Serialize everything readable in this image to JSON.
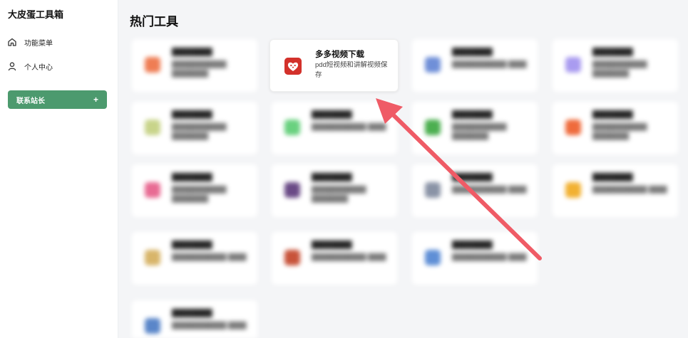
{
  "app": {
    "title": "大皮蛋工具箱"
  },
  "sidebar": {
    "items": [
      {
        "label": "功能菜单",
        "icon": "home-icon"
      },
      {
        "label": "个人中心",
        "icon": "user-icon"
      }
    ],
    "contact": {
      "label": "联系站长",
      "plus": "+"
    }
  },
  "main": {
    "title": "热门工具",
    "featured": {
      "name": "多多视频下载",
      "desc": "pdd短视频和讲解视频保存",
      "icon": "pinduoduo-logo-icon",
      "color": "#d3312b"
    },
    "blurred_cards": [
      {
        "name": "████████",
        "desc": "████████████ ████████",
        "color": "#ef7d54"
      },
      {
        "name": "████████",
        "desc": "████████████ ████",
        "color": "#6f8fd8"
      },
      {
        "name": "████████",
        "desc": "████████████ ████████",
        "color": "#a99bf0"
      },
      {
        "name": "████████",
        "desc": "████████████ ████████",
        "color": "#c8d48a"
      },
      {
        "name": "████████",
        "desc": "████████████ ████",
        "color": "#69d17f"
      },
      {
        "name": "████████",
        "desc": "████████████ ████████",
        "color": "#4caf50"
      },
      {
        "name": "████████",
        "desc": "████████████ ████████",
        "color": "#ef6b3c"
      },
      {
        "name": "████████",
        "desc": "████████████ ████████",
        "color": "#e86b93"
      },
      {
        "name": "████████",
        "desc": "████████████ ████████",
        "color": "#6a4a86"
      },
      {
        "name": "████████",
        "desc": "████████████ ████",
        "color": "#8a93a6"
      },
      {
        "name": "████████",
        "desc": "████████████ ████",
        "color": "#f2b132"
      },
      {
        "name": "████████",
        "desc": "████████████ ████",
        "color": "#d8b56a"
      },
      {
        "name": "████████",
        "desc": "████████████ ████",
        "color": "#c8533a"
      },
      {
        "name": "████████",
        "desc": "████████████ ████",
        "color": "#5f8fd6"
      },
      {
        "name": "████████",
        "desc": "████████████ ████",
        "color": "#5a86c9"
      }
    ]
  },
  "annotation": {
    "arrow_color": "#ef5b66"
  }
}
